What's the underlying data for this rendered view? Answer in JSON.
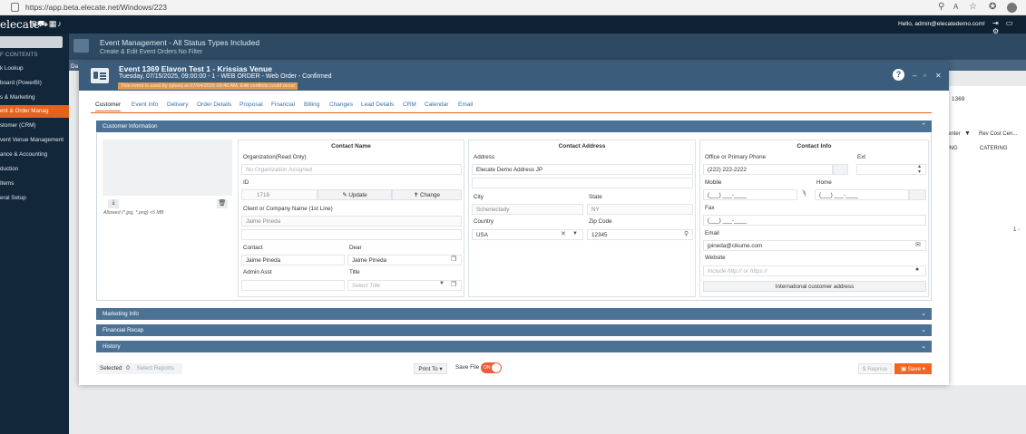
{
  "browser": {
    "url": "https://app.beta.elecate.net/Windows/223"
  },
  "app": {
    "brand": "elecate",
    "brand_icons": "⊞⛟▦♪",
    "user": "Hello, admin@elecatedemo.com!"
  },
  "sidebar": {
    "toc": "F CONTENTS",
    "items": [
      {
        "label": "k Lookup"
      },
      {
        "label": "board (PowerBI)"
      },
      {
        "label": "s & Marketing"
      },
      {
        "label": "ent & Order Manag"
      },
      {
        "label": "stomer (CRM)"
      },
      {
        "label": "vent Venue Management"
      },
      {
        "label": "ance & Accounting"
      },
      {
        "label": "duction"
      },
      {
        "label": "Items"
      },
      {
        "label": "eral Setup"
      }
    ]
  },
  "background": {
    "title": "Event Management - All Status Types Included",
    "subtitle": "Create & Edit Event Orders No Filter",
    "frag1": "Da",
    "frag2": "1369",
    "frag3": "enter",
    "frag4": "Rev Cost Cen...",
    "frag5": "ING",
    "frag6": "CATERING",
    "frag7": "1 -"
  },
  "modal": {
    "title": "Event 1369 Elavon Test 1 - Krissias Venue",
    "subtitle": "Tuesday, 07/15/2025, 09:00:00 - 1 - WEB ORDER - Web Order - Confirmed",
    "warning": "This event is used by (qfast) at 07/04/2025 09:40 AM. Edit conflicts could occur",
    "help": "?",
    "tabs": [
      "Customer",
      "Event Info",
      "Delivery",
      "Order Details",
      "Proposal",
      "Financial",
      "Billing",
      "Changes",
      "Lead Details",
      "CRM",
      "Calendar",
      "Email"
    ],
    "sections": {
      "customer_info": "Customer Information",
      "marketing": "Marketing Info",
      "financial": "Financial Recap",
      "history": "History"
    },
    "image": {
      "allowed": "Allowed (*.jpg, *.png) <5 MB"
    },
    "contact_name": {
      "header": "Contact Name",
      "org_label": "Organization(Read Only)",
      "org_placeholder": "No Organization Assigned",
      "id_label": "ID",
      "id_value": "1718",
      "update": "Update",
      "change": "Change",
      "client_label": "Client or Company Name (1st Line)",
      "client_value": "Jaime Pineda",
      "contact_label": "Contact",
      "contact_value": "Jaime Pineda",
      "dear_label": "Dear",
      "dear_value": "Jaime Pineda",
      "admin_label": "Admin Asst",
      "title_label": "Title",
      "title_placeholder": "Select Title"
    },
    "contact_address": {
      "header": "Contact Address",
      "address_label": "Address",
      "address_value": "Elecate Demo Address JP",
      "city_label": "City",
      "city_value": "Schenectady",
      "state_label": "State",
      "state_value": "NY",
      "country_label": "Country",
      "country_value": "USA",
      "zip_label": "Zip Code",
      "zip_value": "12345"
    },
    "contact_info": {
      "header": "Contact Info",
      "office_label": "Office or Primary Phone",
      "office_value": "(222) 222-2222",
      "ext_label": "Ext",
      "mobile_label": "Mobile",
      "mobile_value": "(___) ___-____",
      "home_label": "Home",
      "home_value": "(___) ___-____",
      "fax_label": "Fax",
      "fax_value": "(___) ___-____",
      "email_label": "Email",
      "email_value": "jpineda@cikume.com",
      "website_label": "Website",
      "website_placeholder": "Include http:// or https://",
      "intl_button": "International customer address"
    },
    "footer": {
      "selected_label": "Selected",
      "selected_count": "0",
      "select_reports": "Select Reports",
      "print_to": "Print To",
      "save_file": "Save File",
      "toggle": "ON",
      "reprice": "Reprice",
      "save": "Save"
    }
  }
}
